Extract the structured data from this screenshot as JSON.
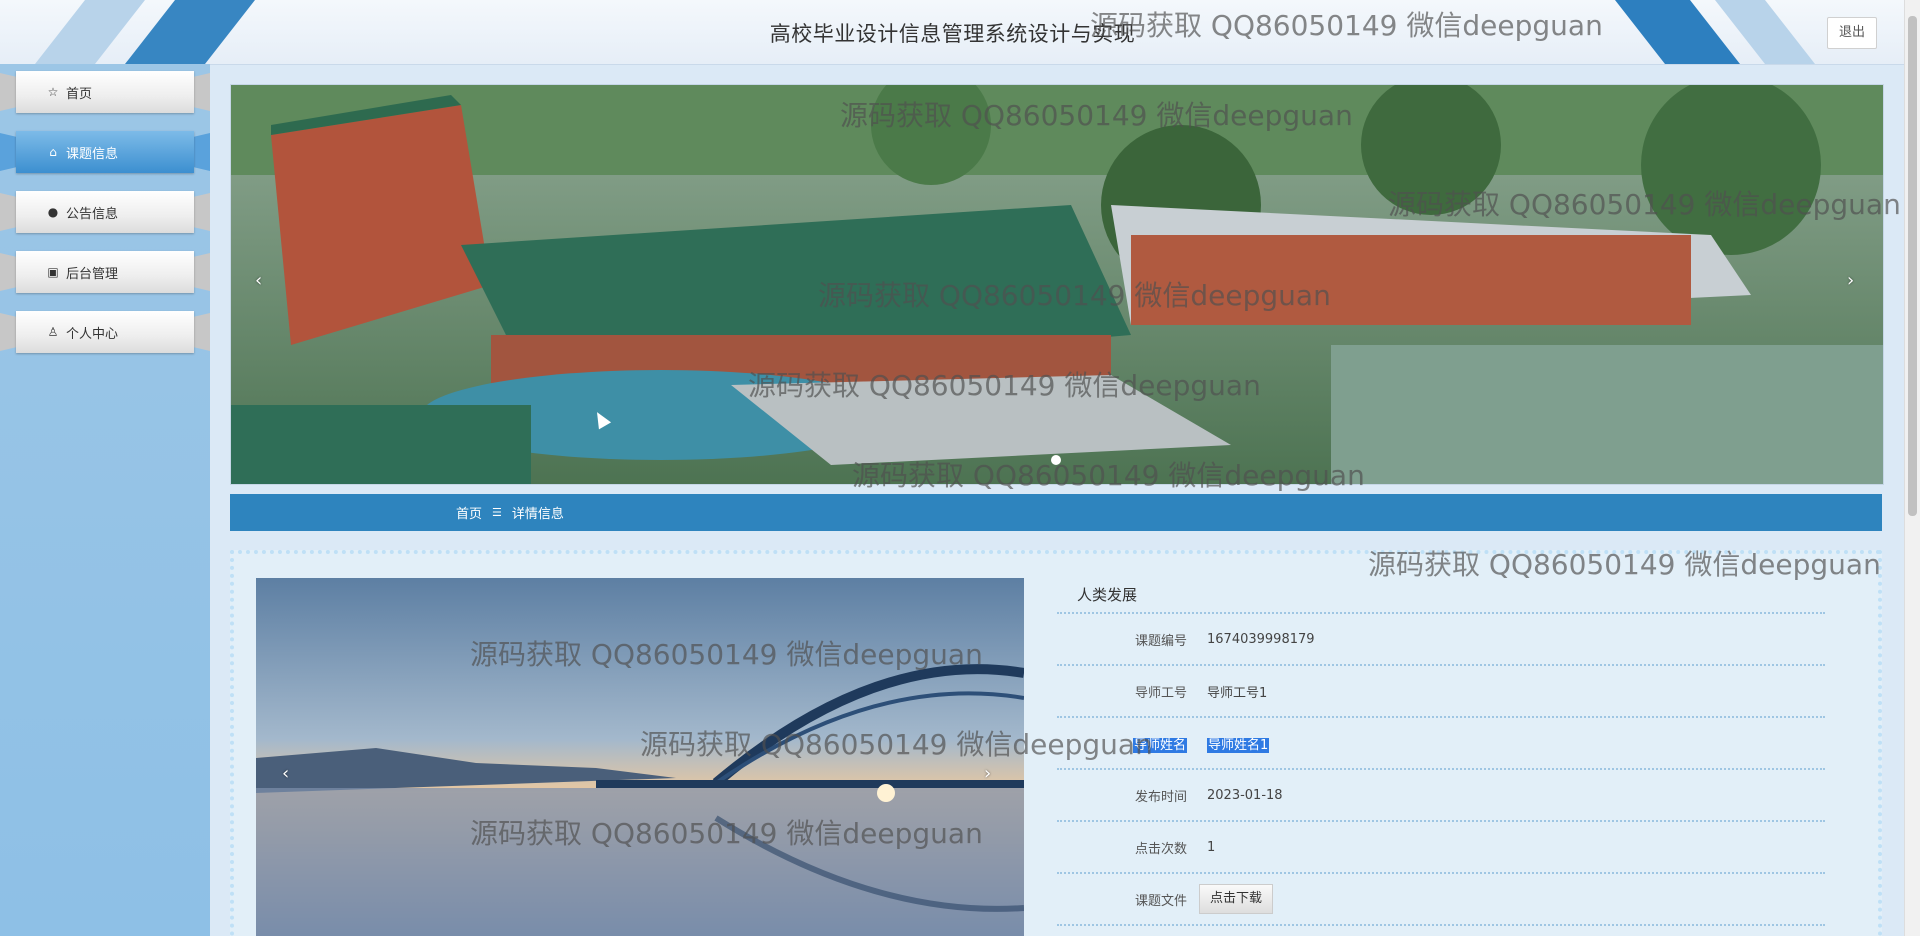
{
  "header": {
    "title": "高校毕业设计信息管理系统设计与实现",
    "logout_label": "退出"
  },
  "sidebar": {
    "items": [
      {
        "label": "首页",
        "icon": "star-icon",
        "active": false
      },
      {
        "label": "课题信息",
        "icon": "bag-icon",
        "active": true
      },
      {
        "label": "公告信息",
        "icon": "alert-icon",
        "active": false
      },
      {
        "label": "后台管理",
        "icon": "briefcase-icon",
        "active": false
      },
      {
        "label": "个人中心",
        "icon": "user-icon",
        "active": false
      }
    ]
  },
  "banner": {
    "prev": "‹",
    "next": "›"
  },
  "breadcrumb": {
    "home": "首页",
    "separator": "☰",
    "current": "详情信息"
  },
  "detail": {
    "title": "人类发展",
    "photo": {
      "prev": "‹",
      "next": "›"
    },
    "fields": [
      {
        "label": "课题编号",
        "value": "1674039998179"
      },
      {
        "label": "导师工号",
        "value": "导师工号1"
      },
      {
        "label": "导师姓名",
        "value": "导师姓名1"
      },
      {
        "label": "发布时间",
        "value": "2023-01-18"
      },
      {
        "label": "点击次数",
        "value": "1"
      },
      {
        "label": "课题文件",
        "button": "点击下载"
      }
    ]
  },
  "watermark": "源码获取 QQ86050149 微信deepguan",
  "colors": {
    "accent": "#2e84be",
    "sidebar": "#9cc6e6",
    "active_nav": "#3c8fd0"
  }
}
